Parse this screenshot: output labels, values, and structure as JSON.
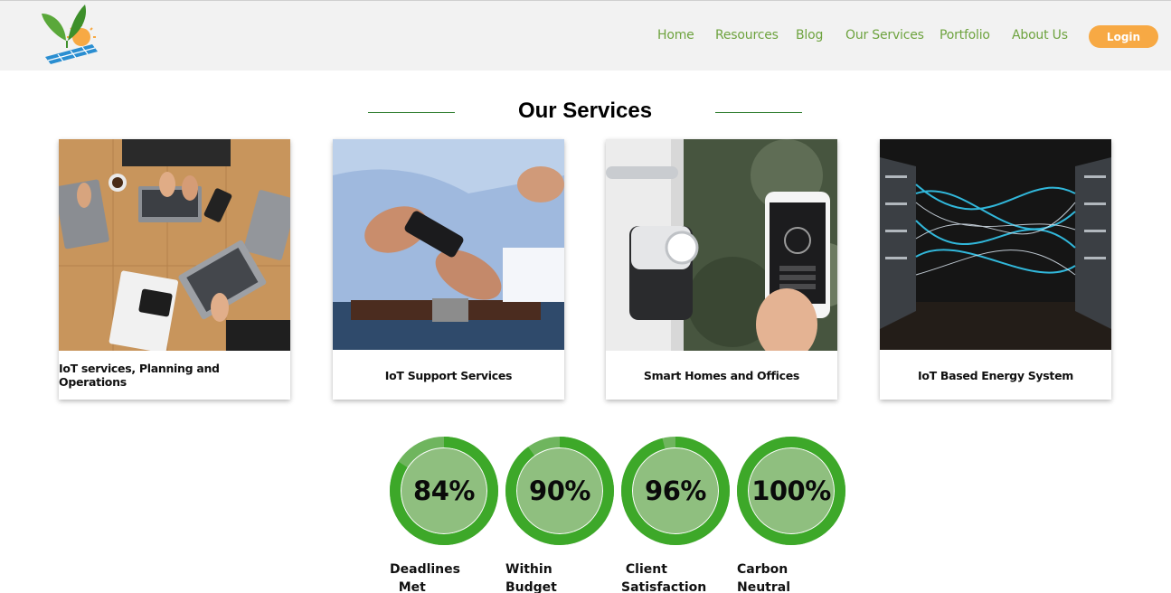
{
  "header": {
    "logo_icon": "leaf-sun-solar-panel-logo",
    "nav": [
      "Home",
      "Resources",
      "Blog",
      "Our Services",
      "Portfolio",
      "About Us"
    ],
    "login_label": "Login",
    "nav_color": "#6ea33f",
    "login_color": "#f7a944"
  },
  "services": {
    "title": "Our Services",
    "cards": [
      {
        "label": "IoT services, Planning and Operations",
        "image": "laptops-on-table-photo"
      },
      {
        "label": "IoT Support Services",
        "image": "hands-holding-phone-photo"
      },
      {
        "label": "Smart Homes and Offices",
        "image": "smart-door-lock-phone-photo"
      },
      {
        "label": "IoT Based Energy System",
        "image": "server-cables-photo"
      }
    ]
  },
  "stats": {
    "ring_color": "#3da829",
    "inner_color": "#8fbf7f",
    "items": [
      {
        "value": "84%",
        "label": "Deadlines\n  Met",
        "percent": 84
      },
      {
        "value": "90%",
        "label": "Within\nBudget",
        "percent": 90
      },
      {
        "value": "96%",
        "label": " Client\nSatisfaction",
        "percent": 96
      },
      {
        "value": "100%",
        "label": "Carbon\nNeutral",
        "percent": 100
      }
    ]
  }
}
